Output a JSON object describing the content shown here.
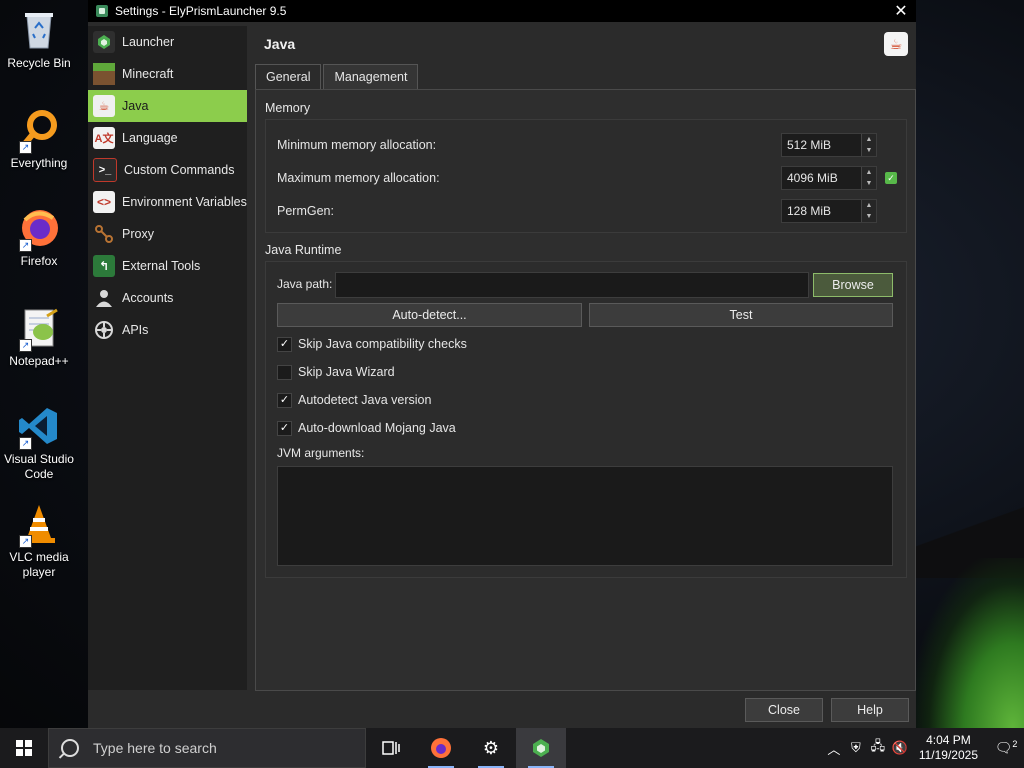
{
  "desktop": {
    "icons": [
      {
        "label": "Recycle Bin",
        "icon": "recycle-bin-icon"
      },
      {
        "label": "Everything",
        "icon": "everything-search-icon"
      },
      {
        "label": "Firefox",
        "icon": "firefox-icon"
      },
      {
        "label": "Notepad++",
        "icon": "notepad-plus-plus-icon"
      },
      {
        "label": "Visual Studio Code",
        "icon": "vscode-icon"
      },
      {
        "label": "VLC media player",
        "icon": "vlc-icon"
      }
    ]
  },
  "window": {
    "title": "Settings - ElyPrismLauncher 9.5",
    "close_glyph": "✕"
  },
  "sidebar": {
    "items": [
      {
        "label": "Launcher",
        "icon": "launcher-icon",
        "color": "#2f2f2f"
      },
      {
        "label": "Minecraft",
        "icon": "minecraft-grass-icon",
        "color": "#5a8a32"
      },
      {
        "label": "Java",
        "icon": "java-icon",
        "color": "#f0f0f0"
      },
      {
        "label": "Language",
        "icon": "language-icon",
        "color": "#f2f2f2"
      },
      {
        "label": "Custom Commands",
        "icon": "terminal-icon",
        "color": "#c0392b"
      },
      {
        "label": "Environment Variables",
        "icon": "code-brackets-icon",
        "color": "#f2f2f2"
      },
      {
        "label": "Proxy",
        "icon": "proxy-icon",
        "color": "#8a5a2a"
      },
      {
        "label": "External Tools",
        "icon": "external-tools-icon",
        "color": "#2c7a3a"
      },
      {
        "label": "Accounts",
        "icon": "accounts-icon",
        "color": "#d8d8d8"
      },
      {
        "label": "APIs",
        "icon": "apis-icon",
        "color": "#d8d8d8"
      }
    ],
    "active_index": 2
  },
  "page": {
    "title": "Java",
    "tabs": [
      "General",
      "Management"
    ],
    "memory": {
      "title": "Memory",
      "rows": [
        {
          "label": "Minimum memory allocation:",
          "value": "512 MiB"
        },
        {
          "label": "Maximum memory allocation:",
          "value": "4096 MiB"
        },
        {
          "label": "PermGen:",
          "value": "128 MiB"
        }
      ]
    },
    "runtime": {
      "title": "Java Runtime",
      "java_path_label": "Java path:",
      "java_path_value": "",
      "browse_label": "Browse",
      "autodetect_label": "Auto-detect...",
      "test_label": "Test",
      "checkboxes": [
        {
          "label": "Skip Java compatibility checks",
          "checked": true
        },
        {
          "label": "Skip Java Wizard",
          "checked": false
        },
        {
          "label": "Autodetect Java version",
          "checked": true
        },
        {
          "label": "Auto-download Mojang Java",
          "checked": true
        }
      ],
      "jvm_label": "JVM arguments:",
      "jvm_value": ""
    }
  },
  "footer": {
    "close_label": "Close",
    "help_label": "Help"
  },
  "taskbar": {
    "search_placeholder": "Type here to search",
    "time": "4:04 PM",
    "date": "11/19/2025",
    "notification_count": "2"
  }
}
